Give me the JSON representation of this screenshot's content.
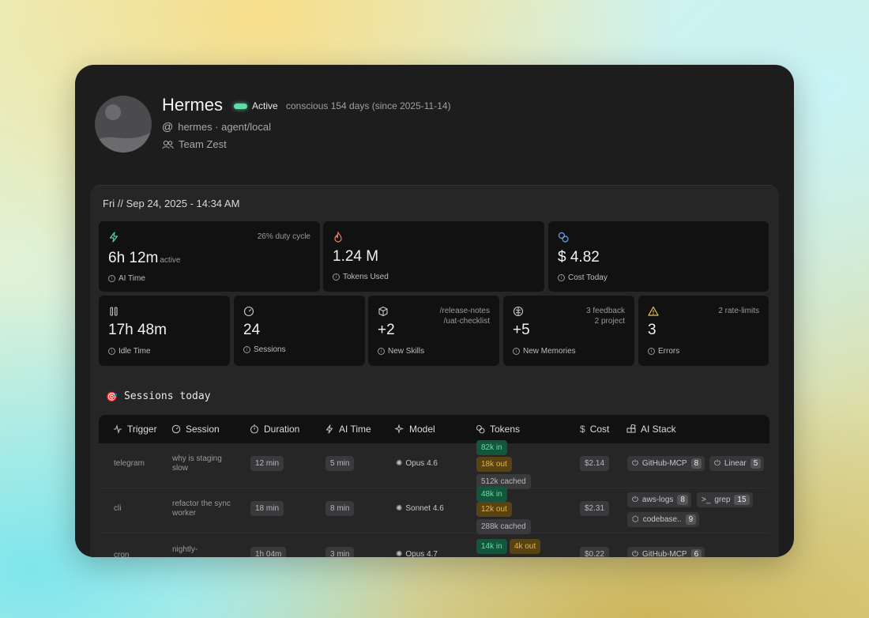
{
  "profile": {
    "name": "Hermes",
    "status": "Active",
    "conscious": "conscious 154 days (since 2025-11-14)",
    "handle": "hermes · agent/local",
    "team": "Team Zest"
  },
  "date": "Fri // Sep 24, 2025 - 14:34 AM",
  "stats": {
    "ai_time": {
      "value": "6h 12m",
      "suffix": "active",
      "side": "26% duty cycle",
      "label": "AI Time"
    },
    "tokens": {
      "value": "1.24 M",
      "label": "Tokens Used"
    },
    "cost": {
      "value": "$ 4.82",
      "label": "Cost Today"
    },
    "idle": {
      "value": "17h 48m",
      "label": "Idle Time"
    },
    "sessions": {
      "value": "24",
      "label": "Sessions"
    },
    "skills": {
      "value": "+2",
      "label": "New Skills",
      "side1": "/release-notes",
      "side2": "/uat-checklist"
    },
    "memories": {
      "value": "+5",
      "label": "New Memories",
      "side1": "3 feedback",
      "side2": "2 project"
    },
    "errors": {
      "value": "3",
      "label": "Errors",
      "side1": "2 rate-limits"
    }
  },
  "sessions_title": "Sessions today",
  "table": {
    "headers": [
      "Trigger",
      "Session",
      "Duration",
      "AI Time",
      "Model",
      "Tokens",
      "Cost",
      "AI Stack"
    ],
    "rows": [
      {
        "trigger": "telegram",
        "session": "why is staging slow",
        "duration": "12 min",
        "ai_time": "5 min",
        "model": "Opus 4.6",
        "tok_in": "82k in",
        "tok_out": "18k out",
        "tok_cached": "512k cached",
        "cost": "$2.14",
        "stack": [
          {
            "name": "GitHub-MCP",
            "n": "8"
          },
          {
            "name": "Linear",
            "n": "5"
          }
        ]
      },
      {
        "trigger": "cli",
        "session": "refactor the sync worker",
        "duration": "18 min",
        "ai_time": "8 min",
        "model": "Sonnet 4.6",
        "tok_in": "48k in",
        "tok_out": "12k out",
        "tok_cached": "288k cached",
        "cost": "$2.31",
        "stack": [
          {
            "name": "aws-logs",
            "n": "8"
          },
          {
            "name": "grep",
            "n": "15"
          },
          {
            "name": "codebase..",
            "n": "9"
          }
        ]
      },
      {
        "trigger": "cron",
        "session": "nightly-",
        "duration": "1h 04m",
        "ai_time": "3 min",
        "model": "Opus 4.7",
        "tok_in": "14k in",
        "tok_out": "4k out",
        "cost": "$0.22",
        "stack": [
          {
            "name": "GitHub-MCP",
            "n": "6"
          }
        ]
      }
    ]
  }
}
